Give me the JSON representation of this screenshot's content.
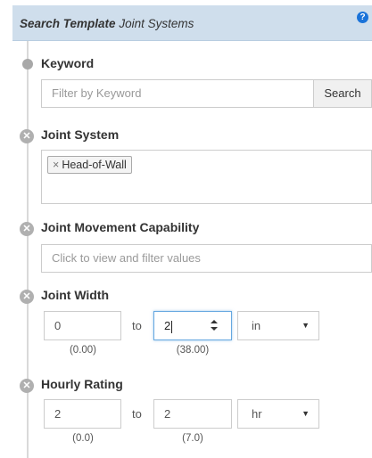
{
  "header": {
    "title_bold": "Search Template",
    "title_rest": "Joint Systems",
    "help_icon": "question-circle-icon",
    "help_glyph": "?"
  },
  "keyword": {
    "label": "Keyword",
    "placeholder": "Filter by Keyword",
    "button": "Search"
  },
  "joint_system": {
    "label": "Joint System",
    "tag_remove": "×",
    "tag": "Head-of-Wall"
  },
  "movement": {
    "label": "Joint Movement Capability",
    "placeholder": "Click to view and filter values"
  },
  "width": {
    "label": "Joint Width",
    "min": "0",
    "to": "to",
    "max": "2",
    "unit": "in",
    "min_hint": "(0.00)",
    "max_hint": "(38.00)"
  },
  "hourly": {
    "label": "Hourly Rating",
    "min": "2",
    "to": "to",
    "max": "2",
    "unit": "hr",
    "min_hint": "(0.0)",
    "max_hint": "(7.0)"
  },
  "icons": {
    "remove_glyph": "✕",
    "caret_glyph": "▼"
  },
  "colors": {
    "header_bg": "#cfdeec",
    "help_icon": "#1a73d9",
    "remove_icon": "#b0b0b0"
  }
}
